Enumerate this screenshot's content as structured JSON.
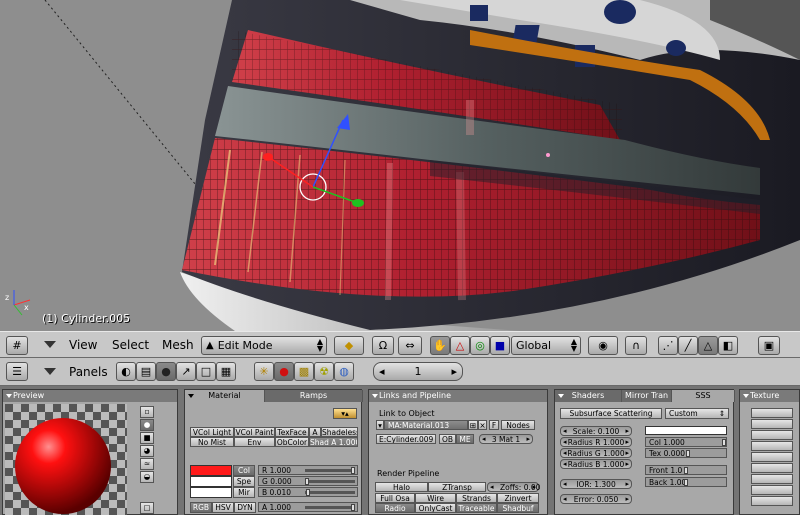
{
  "viewport": {
    "object_label": "(1) Cylinder.005"
  },
  "view_header": {
    "menus": [
      "View",
      "Select",
      "Mesh"
    ],
    "mode": "Edit Mode",
    "orientation": "Global"
  },
  "buttons_header": {
    "panels_label": "Panels",
    "frame": "1"
  },
  "preview_panel": {
    "title": "Preview"
  },
  "material_panel": {
    "tab_material": "Material",
    "tab_ramps": "Ramps",
    "row1": [
      "VCol Light",
      "VCol Paint",
      "TexFace",
      "A",
      "Shadeless"
    ],
    "row2": [
      "No Mist",
      "Env",
      "ObColor",
      "Shad A 1.000"
    ],
    "col_buttons": [
      "Col",
      "Spe",
      "Mir"
    ],
    "r": "R 1.000",
    "g": "G 0.000",
    "b": "B 0.010",
    "alpha": "A 1.000",
    "color_modes": [
      "RGB",
      "HSV",
      "DYN"
    ],
    "col_color": "#ff1a1a",
    "spe_color": "#ffffff",
    "mir_color": "#ffffff"
  },
  "links_panel": {
    "title": "Links and Pipeline",
    "link_label": "Link to Object",
    "material_name": "MA:Material.013",
    "f_button": "F",
    "nodes": "Nodes",
    "mesh_name": "E:Cylinder.009",
    "ob": "OB",
    "me": "ME",
    "mat_count": "3 Mat 1",
    "render_pipeline": "Render Pipeline",
    "pipe_row1": [
      "Halo",
      "ZTransp",
      "Zoffs: 0.00"
    ],
    "pipe_row2": [
      "Full Osa",
      "Wire",
      "Strands",
      "Zinvert"
    ],
    "pipe_row3": [
      "Radio",
      "OnlyCast",
      "Traceable",
      "Shadbuf"
    ]
  },
  "sss_panel": {
    "tab_shaders": "Shaders",
    "tab_mirror": "Mirror Tran",
    "tab_sss": "SSS",
    "sss_toggle": "Subsurface Scattering",
    "preset": "Custom",
    "scale": "Scale: 0.100",
    "radius_r": "Radius R 1.000",
    "radius_g": "Radius G 1.000",
    "radius_b": "Radius B 1.000",
    "ior": "IOR: 1.300",
    "error": "Error: 0.050",
    "col": "Col 1.000",
    "tex": "Tex 0.000",
    "front": "Front 1.0",
    "back": "Back 1.00"
  },
  "texture_panel": {
    "title": "Texture"
  }
}
